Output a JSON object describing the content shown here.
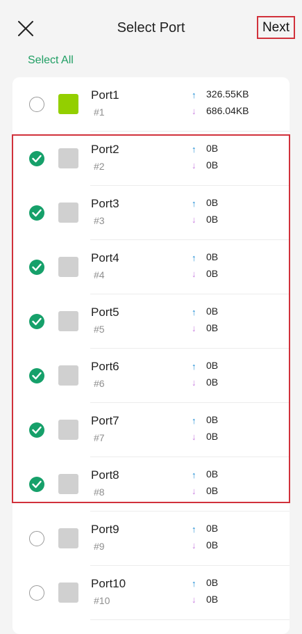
{
  "header": {
    "title": "Select Port",
    "next_label": "Next"
  },
  "select_all_label": "Select All",
  "ports": [
    {
      "name": "Port1",
      "number": "#1",
      "upload": "326.55KB",
      "download": "686.04KB",
      "checked": false,
      "color": "#93cf00"
    },
    {
      "name": "Port2",
      "number": "#2",
      "upload": "0B",
      "download": "0B",
      "checked": true,
      "color": "#d0d0d0"
    },
    {
      "name": "Port3",
      "number": "#3",
      "upload": "0B",
      "download": "0B",
      "checked": true,
      "color": "#d0d0d0"
    },
    {
      "name": "Port4",
      "number": "#4",
      "upload": "0B",
      "download": "0B",
      "checked": true,
      "color": "#d0d0d0"
    },
    {
      "name": "Port5",
      "number": "#5",
      "upload": "0B",
      "download": "0B",
      "checked": true,
      "color": "#d0d0d0"
    },
    {
      "name": "Port6",
      "number": "#6",
      "upload": "0B",
      "download": "0B",
      "checked": true,
      "color": "#d0d0d0"
    },
    {
      "name": "Port7",
      "number": "#7",
      "upload": "0B",
      "download": "0B",
      "checked": true,
      "color": "#d0d0d0"
    },
    {
      "name": "Port8",
      "number": "#8",
      "upload": "0B",
      "download": "0B",
      "checked": true,
      "color": "#d0d0d0"
    },
    {
      "name": "Port9",
      "number": "#9",
      "upload": "0B",
      "download": "0B",
      "checked": false,
      "color": "#d0d0d0"
    },
    {
      "name": "Port10",
      "number": "#10",
      "upload": "0B",
      "download": "0B",
      "checked": false,
      "color": "#d0d0d0"
    }
  ],
  "colors": {
    "accent": "#16a06a",
    "highlight": "#d1313b",
    "upload_arrow": "#1a8bd4",
    "download_arrow": "#c87de0"
  }
}
